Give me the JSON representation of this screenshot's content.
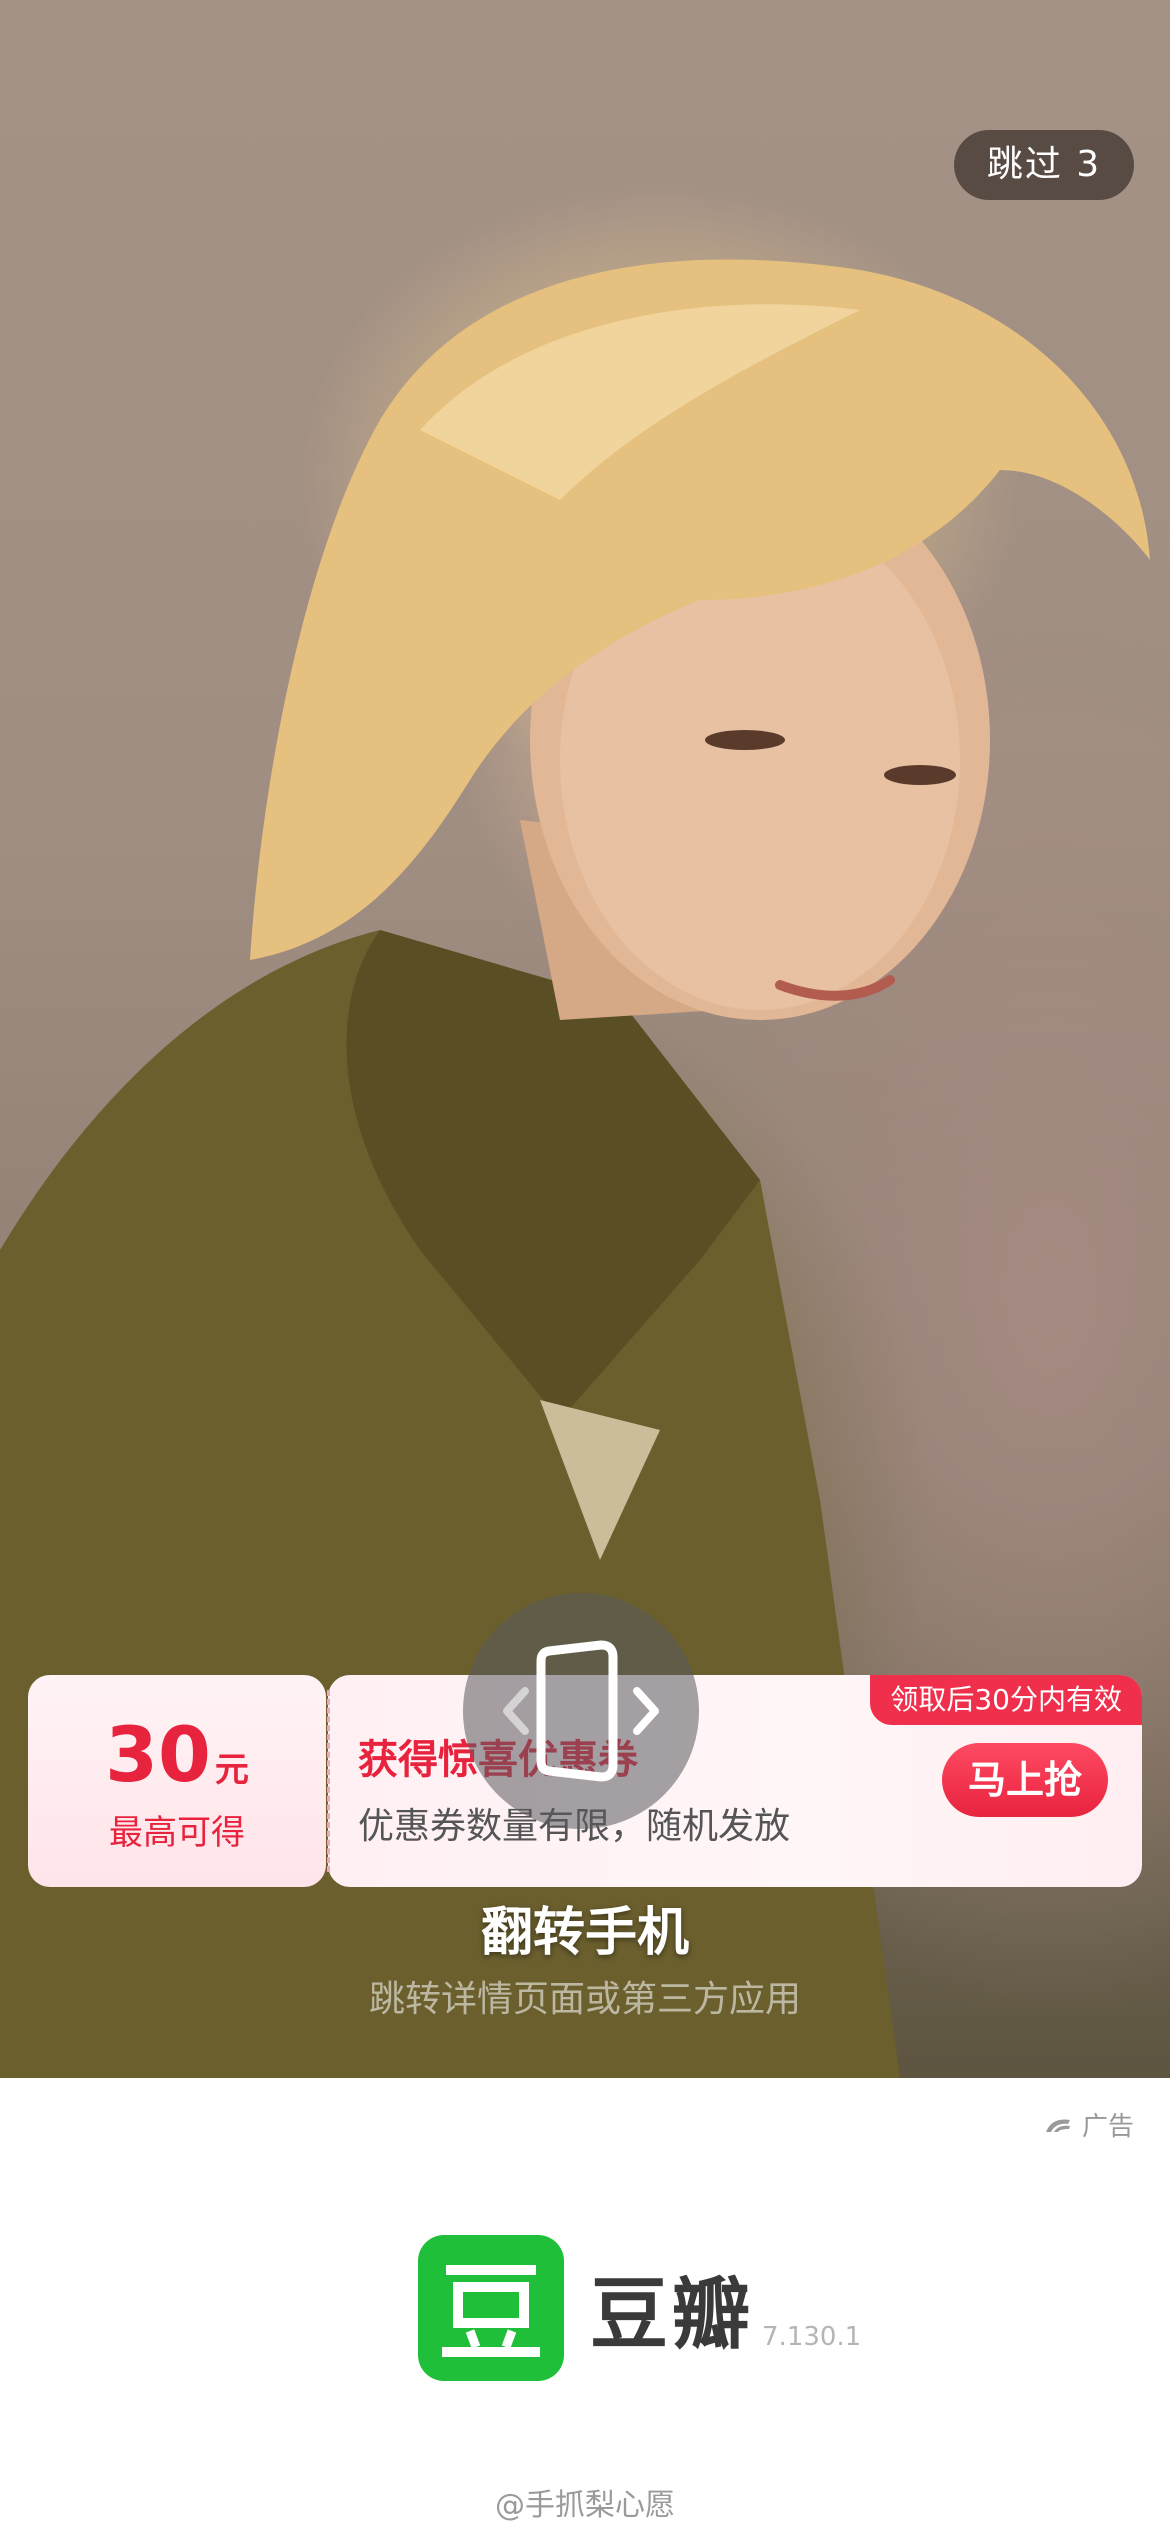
{
  "skip": {
    "label": "跳过",
    "countdown": "3"
  },
  "coupon": {
    "amount": "30",
    "unit": "元",
    "amount_caption": "最高可得",
    "validity_tag": "领取后30分内有效",
    "title": "获得惊喜优惠券",
    "description": "优惠券数量有限，随机发放",
    "grab_label": "马上抢"
  },
  "flip_prompt": {
    "title": "翻转手机",
    "subtitle": "跳转详情页面或第三方应用"
  },
  "footer": {
    "ad_label": "广告",
    "brand_name": "豆瓣",
    "brand_logo_glyph": "豆",
    "version": "7.130.1",
    "watermark": "@手抓梨心愿"
  }
}
